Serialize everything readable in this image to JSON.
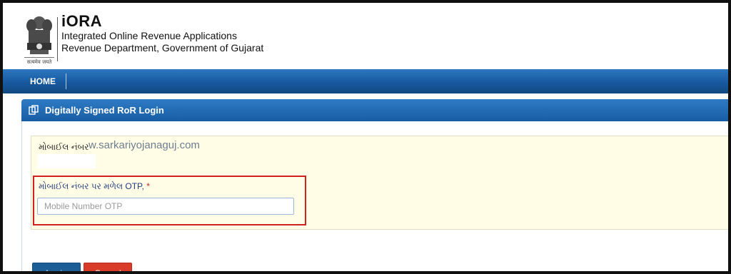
{
  "header": {
    "emblem_caption": "सत्यमेव जयते",
    "app_title": "iORA",
    "subtitle_1": "Integrated Online Revenue Applications",
    "subtitle_2": "Revenue Department, Government of Gujarat"
  },
  "nav": {
    "items": [
      {
        "label": "HOME"
      }
    ]
  },
  "panel": {
    "title": "Digitally Signed RoR Login",
    "mobile_label": "મોબાઈલ નંબર",
    "watermark": "w.sarkariyojanaguj.com",
    "otp_label": "મોબાઈલ નંબર પર મળેલ OTP",
    "required_mark": "*",
    "otp_placeholder": "Mobile Number OTP"
  },
  "buttons": {
    "login": "Login",
    "cancel": "Cancel"
  },
  "colors": {
    "navbar": "#1759a0",
    "form_bg": "#fffde6",
    "highlight_border": "#d32020",
    "login_btn": "#1c5e96",
    "cancel_btn": "#d83b27"
  }
}
